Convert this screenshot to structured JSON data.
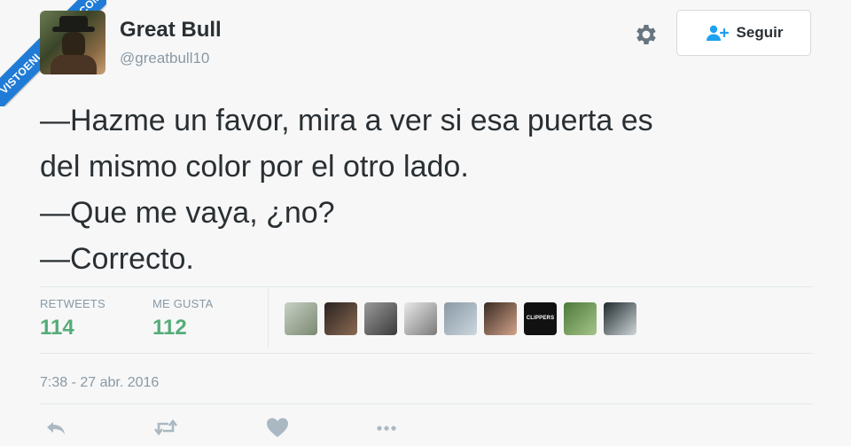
{
  "watermark": {
    "text": "VISTOENLASREDES.COM"
  },
  "author": {
    "name": "Great Bull",
    "handle": "@greatbull10"
  },
  "header": {
    "follow_label": "Seguir"
  },
  "tweet": {
    "lines": [
      "—Hazme un favor, mira a ver si esa puerta es",
      "del mismo color por el otro lado.",
      "—Que me vaya, ¿no?",
      "—Correcto."
    ],
    "timestamp": "7:38 - 27 abr. 2016"
  },
  "stats": {
    "retweets_label": "RETWEETS",
    "retweets_count": "114",
    "likes_label": "ME GUSTA",
    "likes_count": "112"
  },
  "likers": [
    {
      "label": "",
      "colors": [
        "#c8d0c6",
        "#7a8870"
      ]
    },
    {
      "label": "",
      "colors": [
        "#2a2220",
        "#8a6a52"
      ]
    },
    {
      "label": "",
      "colors": [
        "#9a9a9a",
        "#3a3a3a"
      ]
    },
    {
      "label": "",
      "colors": [
        "#e8e8e8",
        "#7a7a7a"
      ]
    },
    {
      "label": "",
      "colors": [
        "#8899a6",
        "#ccd6dd"
      ]
    },
    {
      "label": "",
      "colors": [
        "#3a2a22",
        "#d2a48a"
      ]
    },
    {
      "label": "CLIPPERS",
      "colors": [
        "#111111",
        "#111111"
      ]
    },
    {
      "label": "",
      "colors": [
        "#4d7a3a",
        "#a6c48a"
      ]
    },
    {
      "label": "",
      "colors": [
        "#1e2a2e",
        "#d0d6d8"
      ]
    }
  ],
  "actions": [
    {
      "icon": "reply-icon"
    },
    {
      "icon": "retweet-icon"
    },
    {
      "icon": "like-icon"
    },
    {
      "icon": "more-icon"
    }
  ],
  "colors": {
    "accent": "#55ac78",
    "muted": "#8899a6",
    "text": "#292f33",
    "watermark": "#1f7bd6"
  }
}
